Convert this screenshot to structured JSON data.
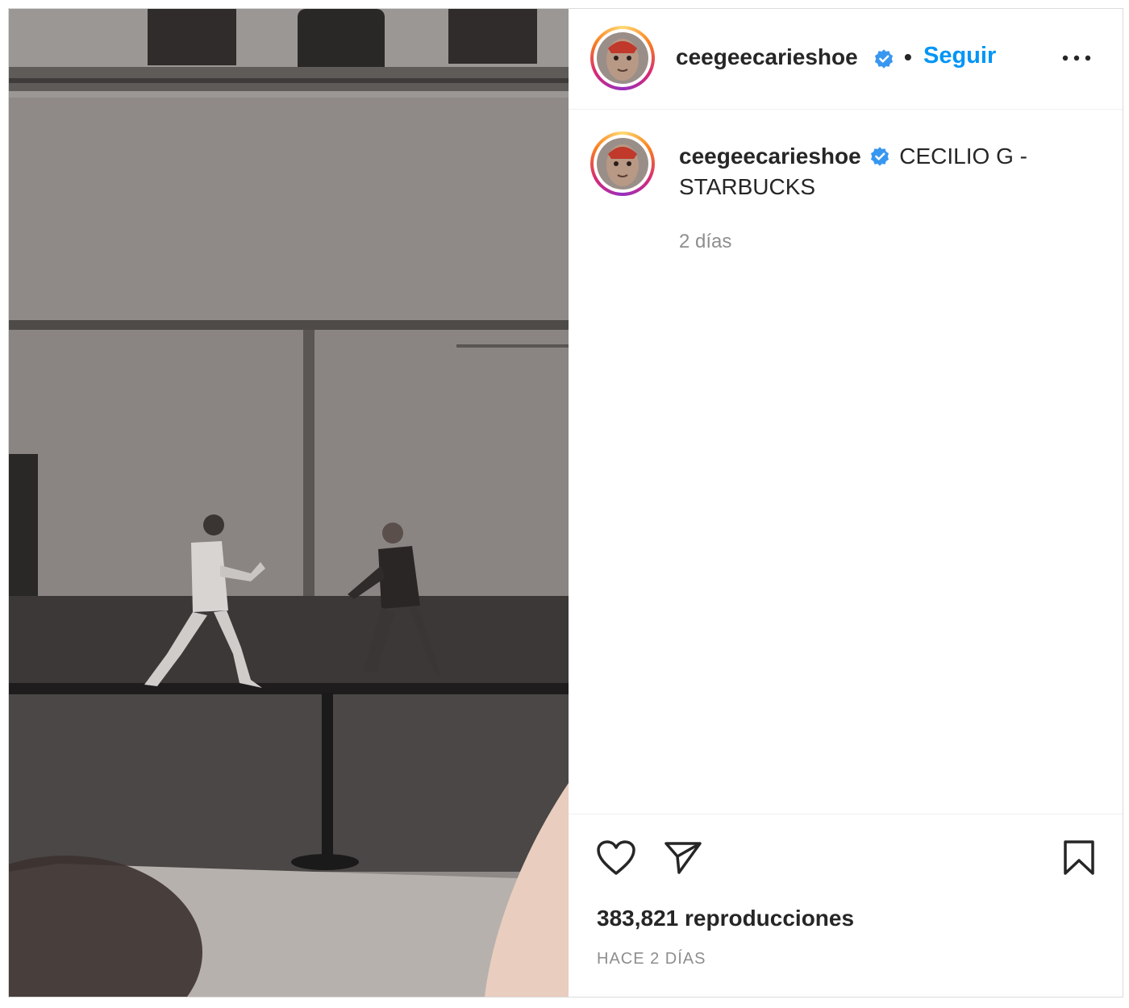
{
  "post": {
    "media": {
      "kind": "video"
    },
    "header": {
      "username": "ceegeecarieshoe",
      "verified": true,
      "separator": "•",
      "follow_label": "Seguir",
      "more_icon": "more-horizontal-icon"
    },
    "caption": {
      "username": "ceegeecarieshoe",
      "text": "CECILIO G - STARBUCKS",
      "time": "2 días"
    },
    "actions": {
      "like_icon": "heart-icon",
      "share_icon": "paper-plane-icon",
      "save_icon": "bookmark-icon"
    },
    "views_text": "383,821 reproducciones",
    "age_text": "HACE 2 DÍAS"
  },
  "colors": {
    "link": "#0095f6",
    "verified": "#3897f0",
    "text": "#262626",
    "muted": "#8e8e8e",
    "border": "#dbdbdb"
  }
}
